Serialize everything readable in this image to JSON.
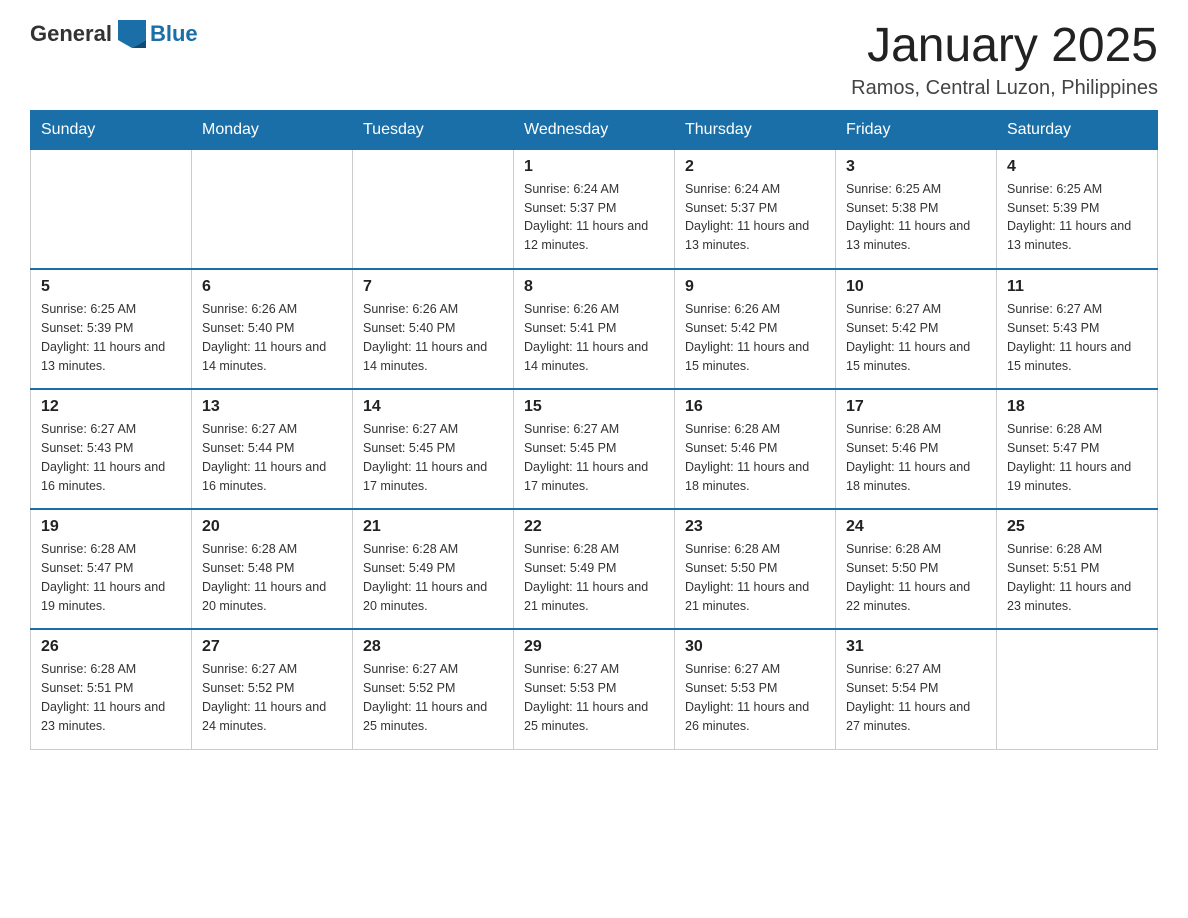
{
  "header": {
    "logo": {
      "general": "General",
      "blue": "Blue"
    },
    "title": "January 2025",
    "location": "Ramos, Central Luzon, Philippines"
  },
  "days_of_week": [
    "Sunday",
    "Monday",
    "Tuesday",
    "Wednesday",
    "Thursday",
    "Friday",
    "Saturday"
  ],
  "weeks": [
    [
      {
        "day": "",
        "info": ""
      },
      {
        "day": "",
        "info": ""
      },
      {
        "day": "",
        "info": ""
      },
      {
        "day": "1",
        "info": "Sunrise: 6:24 AM\nSunset: 5:37 PM\nDaylight: 11 hours and 12 minutes."
      },
      {
        "day": "2",
        "info": "Sunrise: 6:24 AM\nSunset: 5:37 PM\nDaylight: 11 hours and 13 minutes."
      },
      {
        "day": "3",
        "info": "Sunrise: 6:25 AM\nSunset: 5:38 PM\nDaylight: 11 hours and 13 minutes."
      },
      {
        "day": "4",
        "info": "Sunrise: 6:25 AM\nSunset: 5:39 PM\nDaylight: 11 hours and 13 minutes."
      }
    ],
    [
      {
        "day": "5",
        "info": "Sunrise: 6:25 AM\nSunset: 5:39 PM\nDaylight: 11 hours and 13 minutes."
      },
      {
        "day": "6",
        "info": "Sunrise: 6:26 AM\nSunset: 5:40 PM\nDaylight: 11 hours and 14 minutes."
      },
      {
        "day": "7",
        "info": "Sunrise: 6:26 AM\nSunset: 5:40 PM\nDaylight: 11 hours and 14 minutes."
      },
      {
        "day": "8",
        "info": "Sunrise: 6:26 AM\nSunset: 5:41 PM\nDaylight: 11 hours and 14 minutes."
      },
      {
        "day": "9",
        "info": "Sunrise: 6:26 AM\nSunset: 5:42 PM\nDaylight: 11 hours and 15 minutes."
      },
      {
        "day": "10",
        "info": "Sunrise: 6:27 AM\nSunset: 5:42 PM\nDaylight: 11 hours and 15 minutes."
      },
      {
        "day": "11",
        "info": "Sunrise: 6:27 AM\nSunset: 5:43 PM\nDaylight: 11 hours and 15 minutes."
      }
    ],
    [
      {
        "day": "12",
        "info": "Sunrise: 6:27 AM\nSunset: 5:43 PM\nDaylight: 11 hours and 16 minutes."
      },
      {
        "day": "13",
        "info": "Sunrise: 6:27 AM\nSunset: 5:44 PM\nDaylight: 11 hours and 16 minutes."
      },
      {
        "day": "14",
        "info": "Sunrise: 6:27 AM\nSunset: 5:45 PM\nDaylight: 11 hours and 17 minutes."
      },
      {
        "day": "15",
        "info": "Sunrise: 6:27 AM\nSunset: 5:45 PM\nDaylight: 11 hours and 17 minutes."
      },
      {
        "day": "16",
        "info": "Sunrise: 6:28 AM\nSunset: 5:46 PM\nDaylight: 11 hours and 18 minutes."
      },
      {
        "day": "17",
        "info": "Sunrise: 6:28 AM\nSunset: 5:46 PM\nDaylight: 11 hours and 18 minutes."
      },
      {
        "day": "18",
        "info": "Sunrise: 6:28 AM\nSunset: 5:47 PM\nDaylight: 11 hours and 19 minutes."
      }
    ],
    [
      {
        "day": "19",
        "info": "Sunrise: 6:28 AM\nSunset: 5:47 PM\nDaylight: 11 hours and 19 minutes."
      },
      {
        "day": "20",
        "info": "Sunrise: 6:28 AM\nSunset: 5:48 PM\nDaylight: 11 hours and 20 minutes."
      },
      {
        "day": "21",
        "info": "Sunrise: 6:28 AM\nSunset: 5:49 PM\nDaylight: 11 hours and 20 minutes."
      },
      {
        "day": "22",
        "info": "Sunrise: 6:28 AM\nSunset: 5:49 PM\nDaylight: 11 hours and 21 minutes."
      },
      {
        "day": "23",
        "info": "Sunrise: 6:28 AM\nSunset: 5:50 PM\nDaylight: 11 hours and 21 minutes."
      },
      {
        "day": "24",
        "info": "Sunrise: 6:28 AM\nSunset: 5:50 PM\nDaylight: 11 hours and 22 minutes."
      },
      {
        "day": "25",
        "info": "Sunrise: 6:28 AM\nSunset: 5:51 PM\nDaylight: 11 hours and 23 minutes."
      }
    ],
    [
      {
        "day": "26",
        "info": "Sunrise: 6:28 AM\nSunset: 5:51 PM\nDaylight: 11 hours and 23 minutes."
      },
      {
        "day": "27",
        "info": "Sunrise: 6:27 AM\nSunset: 5:52 PM\nDaylight: 11 hours and 24 minutes."
      },
      {
        "day": "28",
        "info": "Sunrise: 6:27 AM\nSunset: 5:52 PM\nDaylight: 11 hours and 25 minutes."
      },
      {
        "day": "29",
        "info": "Sunrise: 6:27 AM\nSunset: 5:53 PM\nDaylight: 11 hours and 25 minutes."
      },
      {
        "day": "30",
        "info": "Sunrise: 6:27 AM\nSunset: 5:53 PM\nDaylight: 11 hours and 26 minutes."
      },
      {
        "day": "31",
        "info": "Sunrise: 6:27 AM\nSunset: 5:54 PM\nDaylight: 11 hours and 27 minutes."
      },
      {
        "day": "",
        "info": ""
      }
    ]
  ]
}
